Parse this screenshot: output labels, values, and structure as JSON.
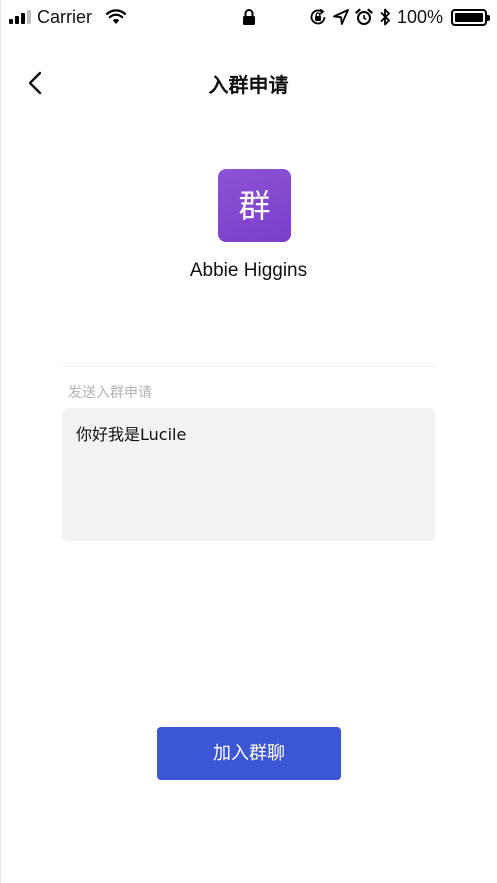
{
  "status_bar": {
    "carrier": "Carrier",
    "battery_percent": "100%"
  },
  "nav": {
    "title": "入群申请",
    "back_icon": "chevron-left-icon"
  },
  "group": {
    "avatar_text": "群",
    "avatar_color": "#8447D1",
    "name": "Abbie Higgins"
  },
  "request": {
    "label": "发送入群申请",
    "message": "你好我是Lucile"
  },
  "actions": {
    "join_label": "加入群聊",
    "join_color": "#3B57D6"
  }
}
